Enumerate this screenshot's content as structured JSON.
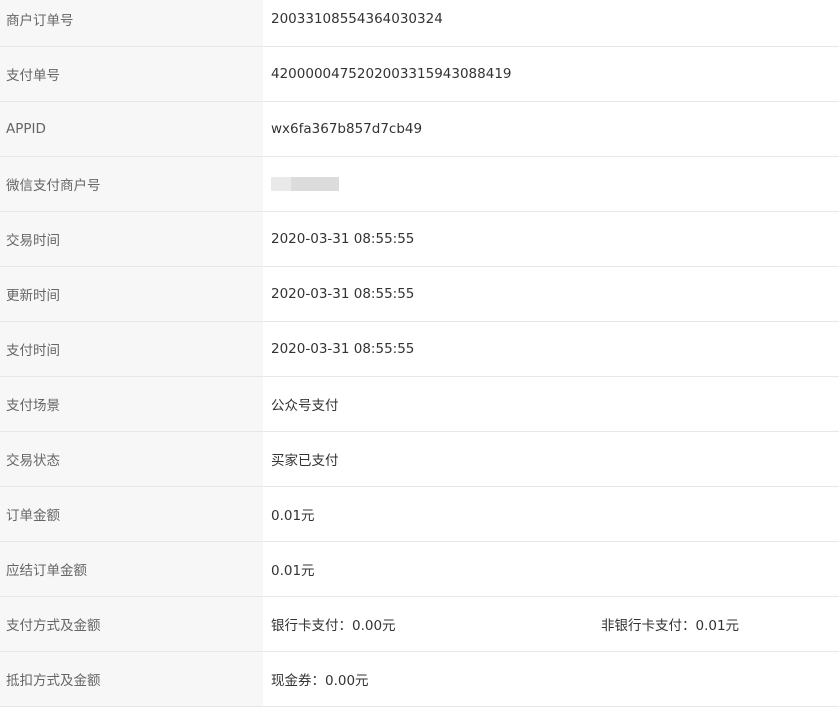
{
  "rows": [
    {
      "label": "商户订单号",
      "value": "2003310855436403032​4"
    },
    {
      "label": "支付单号",
      "value": "4200000475202003315943088419"
    },
    {
      "label": "APPID",
      "value": "wx6fa367b857d7cb49"
    },
    {
      "label": "微信支付商户号",
      "value": ""
    },
    {
      "label": "交易时间",
      "value": "2020-03-31 08:55:55"
    },
    {
      "label": "更新时间",
      "value": "2020-03-31 08:55:55"
    },
    {
      "label": "支付时间",
      "value": "2020-03-31 08:55:55"
    },
    {
      "label": "支付场景",
      "value": "公众号支付"
    },
    {
      "label": "交易状态",
      "value": "买家已支付"
    },
    {
      "label": "订单金额",
      "value": "0.01元"
    },
    {
      "label": "应结订单金额",
      "value": "0.01元"
    },
    {
      "label": "支付方式及金额",
      "value_left": "银行卡支付：0.00元",
      "value_right": "非银行卡支付：0.01元"
    },
    {
      "label": "抵扣方式及金额",
      "value": "现金券：0.00元"
    }
  ]
}
